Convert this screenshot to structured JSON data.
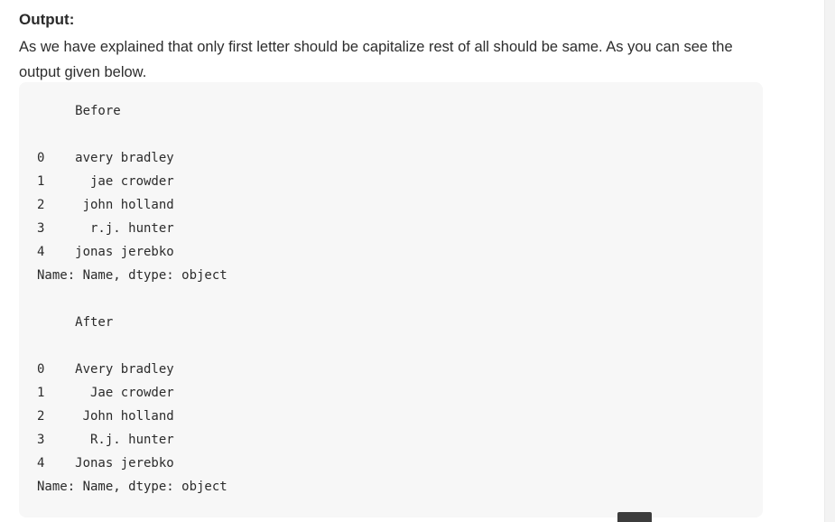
{
  "section": {
    "heading": "Output:",
    "paragraph": "As we have explained that only first letter should be capitalize rest of all should be same. As you can see the output given below."
  },
  "code_output": {
    "lines": [
      "     Before",
      "",
      "0    avery bradley",
      "1      jae crowder",
      "2     john holland",
      "3      r.j. hunter",
      "4    jonas jerebko",
      "Name: Name, dtype: object",
      "",
      "     After",
      "",
      "0    Avery bradley",
      "1      Jae crowder",
      "2     John holland",
      "3      R.j. hunter",
      "4    Jonas jerebko",
      "Name: Name, dtype: object"
    ]
  }
}
